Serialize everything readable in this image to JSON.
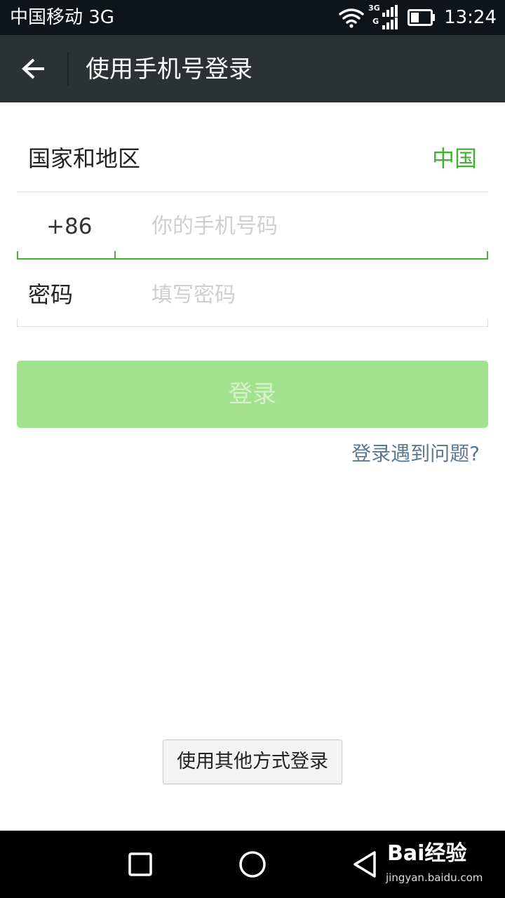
{
  "status_bar": {
    "carrier": "中国移动 3G",
    "network_top": "3G",
    "network_bottom": "G",
    "time": "13:24",
    "icons": [
      "wifi-icon",
      "signal-icon",
      "battery-icon"
    ]
  },
  "header": {
    "back_icon": "arrow-left-icon",
    "title": "使用手机号登录"
  },
  "form": {
    "country_label": "国家和地区",
    "country_value": "中国",
    "country_code": "+86",
    "phone_placeholder": "你的手机号码",
    "password_label": "密码",
    "password_placeholder": "填写密码"
  },
  "login_button": "登录",
  "trouble_link": "登录遇到问题?",
  "other_login_button": "使用其他方式登录",
  "nav_bar": {
    "icons": [
      "recent-apps-icon",
      "home-icon",
      "back-icon"
    ],
    "watermark_brand": "Bai经验",
    "watermark_url": "jingyan.baidu.com"
  },
  "colors": {
    "accent_green": "#45b035",
    "disabled_button": "#a2e28e",
    "link": "#5c7891",
    "header_bg": "#2c3133"
  }
}
